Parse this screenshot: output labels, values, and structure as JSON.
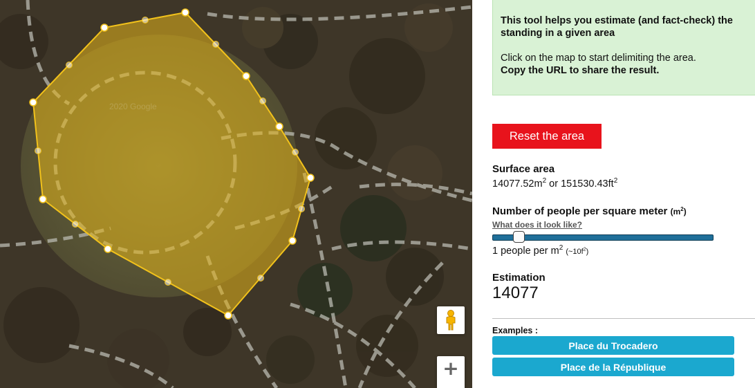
{
  "map": {
    "watermark": "2020 Google",
    "pegman_icon": "pegman-icon",
    "zoom_in_label": "+",
    "polygon_fill": "#e3b41a",
    "polygon_stroke": "#f2c21b"
  },
  "info": {
    "intro_line1": "This tool helps you estimate (and fact-check) the",
    "intro_line2": "standing in a given area",
    "click_text": "Click on the map to start delimiting the area.",
    "copy_text": "Copy the URL to share the result."
  },
  "reset_button": "Reset the area",
  "surface": {
    "title": "Surface area",
    "m2_value": "14077.52m",
    "m2_sup": "2",
    "or_text": " or ",
    "ft2_value": "151530.43ft",
    "ft2_sup": "2"
  },
  "density": {
    "title": "Number of people per square meter",
    "unit_open": "(m",
    "unit_sup": "2",
    "unit_close": ")",
    "link": "What does it look like?",
    "slider_value": 1,
    "slider_min": 0,
    "slider_max": 10,
    "value_text": "1 people per m",
    "value_sup": "2",
    "approx_open": "(~10f",
    "approx_sup": "2",
    "approx_close": ")"
  },
  "estimation": {
    "title": "Estimation",
    "value": "14077"
  },
  "examples": {
    "label": "Examples :",
    "buttons": [
      "Place du Trocadero",
      "Place de la République"
    ]
  },
  "colors": {
    "reset_button": "#e8131c",
    "example_button": "#1ba8cf",
    "info_box": "#d9f2d5",
    "slider": "#1f6f99"
  }
}
